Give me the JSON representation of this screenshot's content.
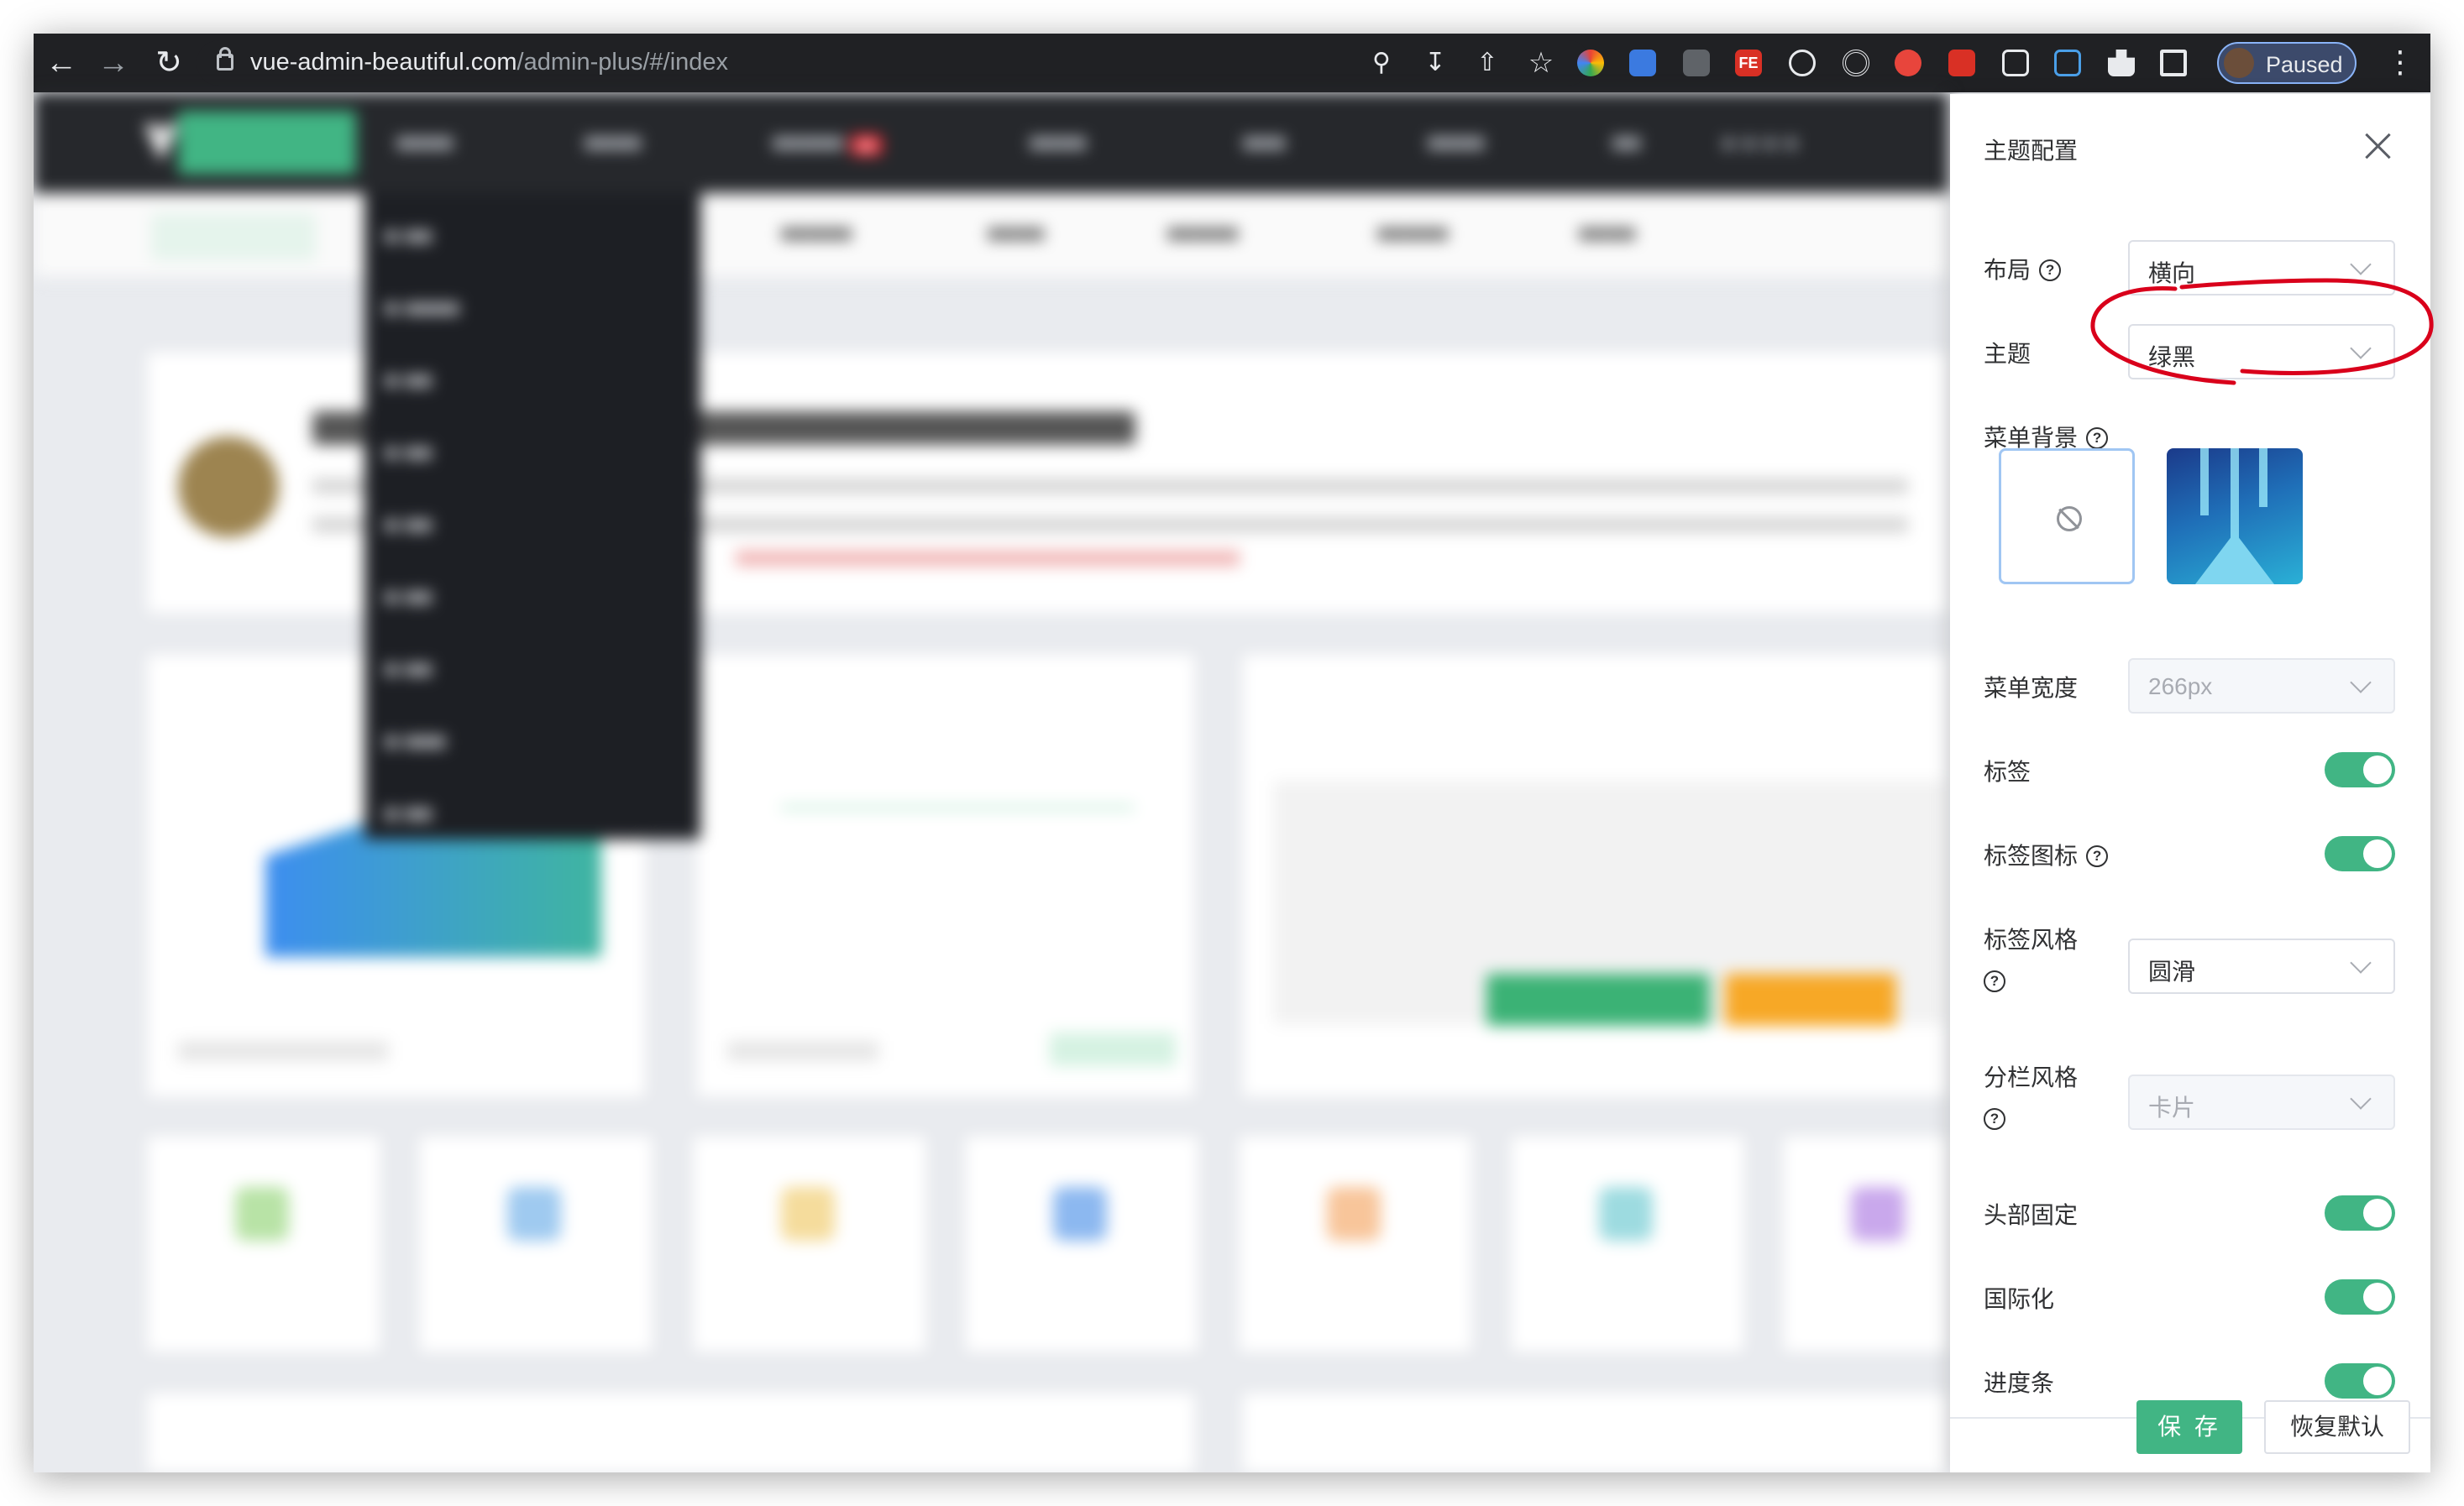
{
  "browser": {
    "url_host": "vue-admin-beautiful.com",
    "url_path": "/admin-plus/#/index",
    "profile_status": "Paused"
  },
  "theme_drawer": {
    "title": "主题配置",
    "layout": {
      "label": "布局",
      "value": "横向"
    },
    "theme": {
      "label": "主题",
      "value": "绿黑"
    },
    "menu_background": {
      "label": "菜单背景"
    },
    "menu_width": {
      "label": "菜单宽度",
      "value": "266px"
    },
    "tabs": {
      "label": "标签",
      "on": true
    },
    "tab_icons": {
      "label": "标签图标",
      "on": true
    },
    "tab_style": {
      "label": "标签风格",
      "value": "圆滑"
    },
    "column_style": {
      "label": "分栏风格",
      "value": "卡片"
    },
    "fixed_header": {
      "label": "头部固定",
      "on": true
    },
    "i18n": {
      "label": "国际化",
      "on": true
    },
    "progress_bar": {
      "label": "进度条",
      "on": true
    },
    "save_label": "保 存",
    "reset_label": "恢复默认"
  },
  "colors": {
    "accent": "#41b584",
    "annotation": "#d9001b",
    "nav_bg": "#26282c"
  }
}
